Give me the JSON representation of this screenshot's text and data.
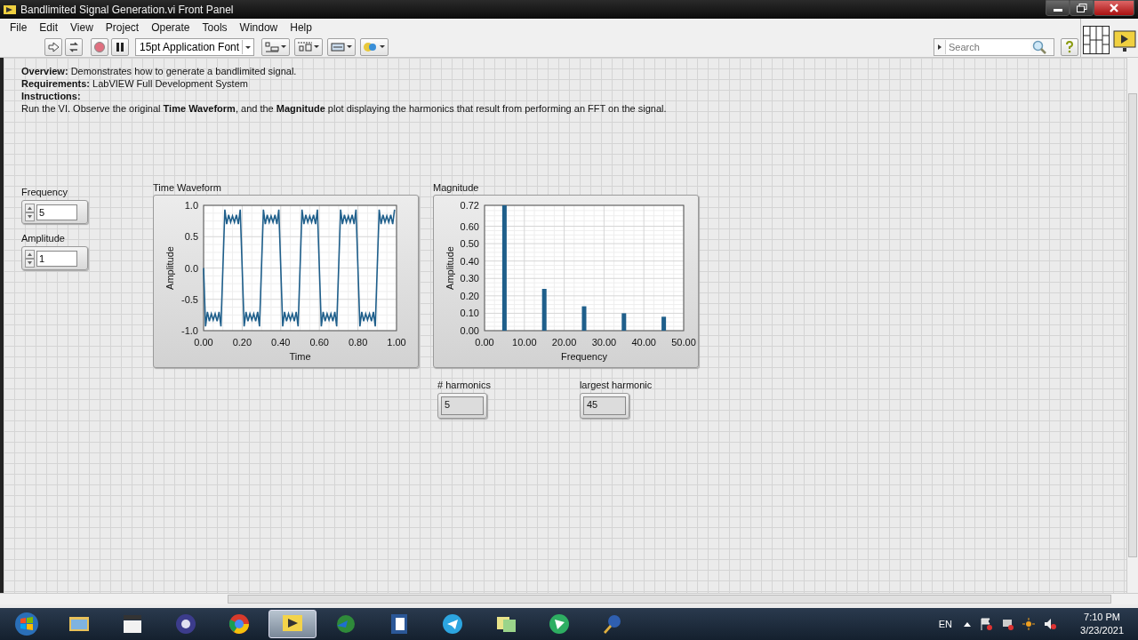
{
  "window": {
    "title": "Bandlimited Signal Generation.vi Front Panel"
  },
  "menu": [
    "File",
    "Edit",
    "View",
    "Project",
    "Operate",
    "Tools",
    "Window",
    "Help"
  ],
  "toolbar": {
    "font": "15pt Application Font",
    "search": {
      "placeholder": "Search"
    }
  },
  "description": [
    "**Overview:** Demonstrates how to generate a bandlimited signal.",
    "**Requirements:** LabVIEW Full Development System",
    "**Instructions:**",
    "Run the VI. Observe the original **Time Waveform**, and the **Magnitude** plot displaying the harmonics that result from performing an FFT on the signal."
  ],
  "controls": [
    {
      "label": "Frequency",
      "value": "5"
    },
    {
      "label": "Amplitude",
      "value": "1"
    }
  ],
  "graphs": [
    {
      "chart_data": {
        "type": "line",
        "title": "Time Waveform",
        "xlabel": "Time",
        "ylabel": "Amplitude",
        "x": [
          0,
          0.01,
          0.02,
          0.03,
          0.04,
          0.05,
          0.06,
          0.07,
          0.08,
          0.09,
          0.1,
          0.11,
          0.12,
          0.13,
          0.14,
          0.15,
          0.16,
          0.17,
          0.18,
          0.19,
          0.2,
          0.21,
          0.22,
          0.23,
          0.24,
          0.25,
          0.26,
          0.27,
          0.28,
          0.29,
          0.3,
          0.31,
          0.32,
          0.33,
          0.34,
          0.35,
          0.36,
          0.37,
          0.38,
          0.39,
          0.4,
          0.41,
          0.42,
          0.43,
          0.44,
          0.45,
          0.46,
          0.47,
          0.48,
          0.49,
          0.5,
          0.51,
          0.52,
          0.53,
          0.54,
          0.55,
          0.56,
          0.57,
          0.58,
          0.59,
          0.6,
          0.61,
          0.62,
          0.63,
          0.64,
          0.65,
          0.66,
          0.67,
          0.68,
          0.69,
          0.7,
          0.71,
          0.72,
          0.73,
          0.74,
          0.75,
          0.76,
          0.77,
          0.78,
          0.79,
          0.8,
          0.81,
          0.82,
          0.83,
          0.84,
          0.85,
          0.86,
          0.87,
          0.88,
          0.89,
          0.9,
          0.91,
          0.92,
          0.93,
          0.94,
          0.95,
          0.96,
          0.97,
          0.98,
          0.99
        ],
        "grid": true,
        "series": [
          {
            "color": "#1f5f8b",
            "values": [
              0,
              -0.93,
              -0.7,
              -0.85,
              -0.73,
              -0.83,
              -0.73,
              -0.85,
              -0.7,
              -0.93,
              0,
              0.93,
              0.7,
              0.85,
              0.73,
              0.83,
              0.73,
              0.85,
              0.7,
              0.93,
              0,
              -0.93,
              -0.7,
              -0.85,
              -0.73,
              -0.83,
              -0.73,
              -0.85,
              -0.7,
              -0.93,
              0,
              0.93,
              0.7,
              0.85,
              0.73,
              0.83,
              0.73,
              0.85,
              0.7,
              0.93,
              0,
              -0.93,
              -0.7,
              -0.85,
              -0.73,
              -0.83,
              -0.73,
              -0.85,
              -0.7,
              -0.93,
              0,
              0.93,
              0.7,
              0.85,
              0.73,
              0.83,
              0.73,
              0.85,
              0.7,
              0.93,
              0,
              -0.93,
              -0.7,
              -0.85,
              -0.73,
              -0.83,
              -0.73,
              -0.85,
              -0.7,
              -0.93,
              0,
              0.93,
              0.7,
              0.85,
              0.73,
              0.83,
              0.73,
              0.85,
              0.7,
              0.93,
              0,
              -0.93,
              -0.7,
              -0.85,
              -0.73,
              -0.83,
              -0.73,
              -0.85,
              -0.7,
              -0.93,
              0,
              0.93,
              0.7,
              0.85,
              0.73,
              0.83,
              0.73,
              0.85,
              0.7,
              0.93
            ]
          }
        ],
        "xlim": [
          0,
          1
        ],
        "ylim": [
          -1,
          1
        ],
        "xticks": [
          {
            "value": 0,
            "label": "0.00"
          },
          {
            "value": 0.2,
            "label": "0.20"
          },
          {
            "value": 0.4,
            "label": "0.40"
          },
          {
            "value": 0.6,
            "label": "0.60"
          },
          {
            "value": 0.8,
            "label": "0.80"
          },
          {
            "value": 1,
            "label": "1.00"
          }
        ],
        "yticks": [
          {
            "value": 1,
            "label": "1.0"
          },
          {
            "value": 0.5,
            "label": "0.5"
          },
          {
            "value": 0,
            "label": "0.0"
          },
          {
            "value": -0.5,
            "label": "-0.5"
          },
          {
            "value": -1,
            "label": "-1.0"
          }
        ]
      }
    },
    {
      "chart_data": {
        "type": "bar",
        "title": "Magnitude",
        "xlabel": "Frequency",
        "ylabel": "Amplitude",
        "x": [
          5,
          15,
          25,
          35,
          45
        ],
        "grid": true,
        "series": [
          {
            "color": "#1f5f8b",
            "values": [
              0.72,
              0.24,
              0.14,
              0.1,
              0.08
            ]
          }
        ],
        "xlim": [
          0,
          50
        ],
        "ylim": [
          0,
          0.72
        ],
        "xticks": [
          {
            "value": 0,
            "label": "0.00"
          },
          {
            "value": 10,
            "label": "10.00"
          },
          {
            "value": 20,
            "label": "20.00"
          },
          {
            "value": 30,
            "label": "30.00"
          },
          {
            "value": 40,
            "label": "40.00"
          },
          {
            "value": 50,
            "label": "50.00"
          }
        ],
        "yticks": [
          {
            "value": 0.72,
            "label": "0.72"
          },
          {
            "value": 0.6,
            "label": "0.60"
          },
          {
            "value": 0.5,
            "label": "0.50"
          },
          {
            "value": 0.4,
            "label": "0.40"
          },
          {
            "value": 0.3,
            "label": "0.30"
          },
          {
            "value": 0.2,
            "label": "0.20"
          },
          {
            "value": 0.1,
            "label": "0.10"
          },
          {
            "value": 0,
            "label": "0.00"
          }
        ]
      }
    }
  ],
  "indicators": [
    {
      "label": "# harmonics",
      "value": "5"
    },
    {
      "label": "largest harmonic",
      "value": "45"
    }
  ],
  "taskbar": {
    "apps": [
      {
        "selected": false
      },
      {
        "selected": false
      },
      {
        "selected": false
      },
      {
        "selected": false
      },
      {
        "selected": true
      },
      {
        "selected": false
      },
      {
        "selected": false
      },
      {
        "selected": false
      },
      {
        "selected": false
      },
      {
        "selected": false
      },
      {
        "selected": false
      }
    ],
    "language": "EN",
    "time": "7:10 PM",
    "date": "3/23/2021"
  }
}
